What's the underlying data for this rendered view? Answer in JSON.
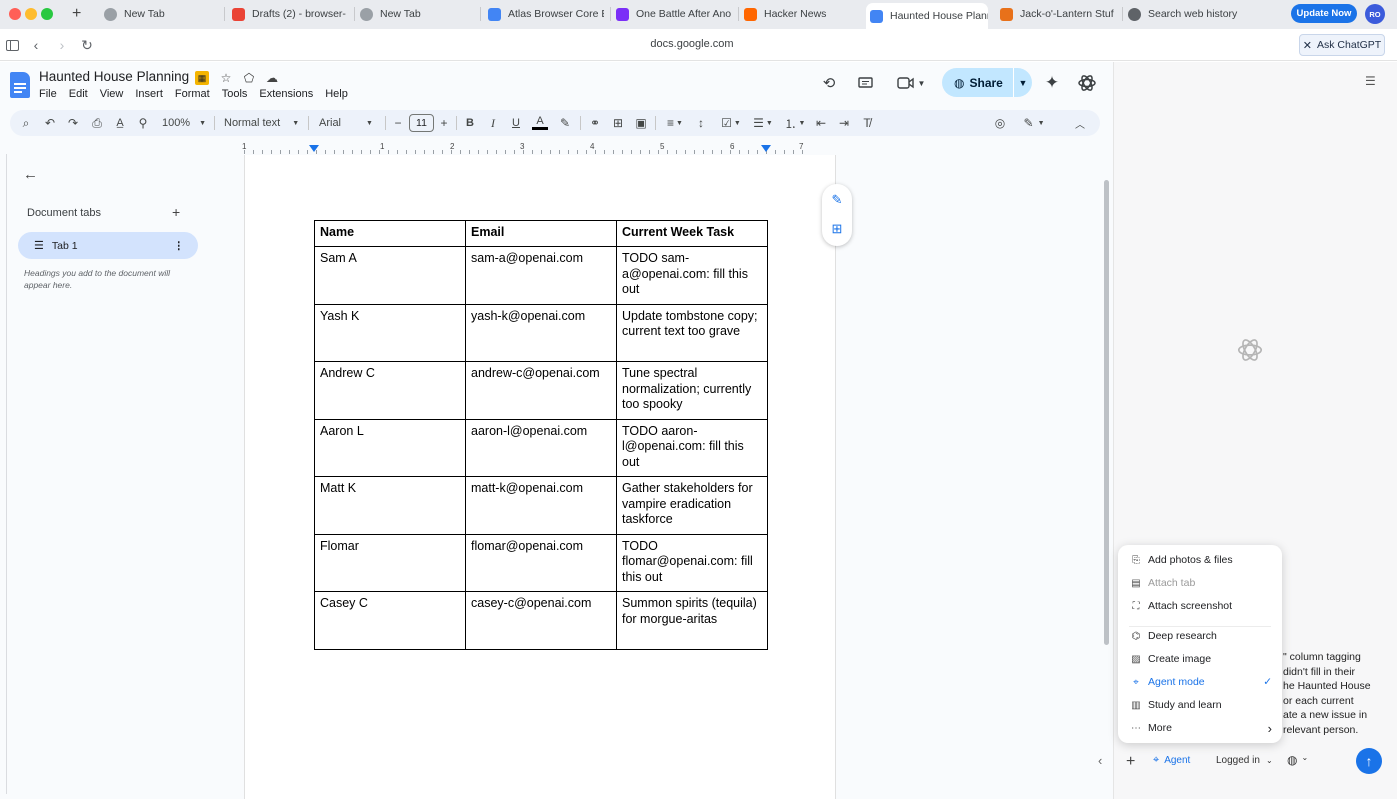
{
  "tabs": [
    {
      "label": "New Tab",
      "icon": "compass-icon",
      "color": "#9aa0a6"
    },
    {
      "label": "Drafts (2) - browser-",
      "icon": "gmail-icon",
      "color": "#ea4335"
    },
    {
      "label": "New Tab",
      "icon": "compass-icon",
      "color": "#9aa0a6"
    },
    {
      "label": "Atlas Browser Core E",
      "icon": "docs-icon",
      "color": "#4285f4"
    },
    {
      "label": "One Battle After Ano",
      "icon": "film-icon",
      "color": "#7b2ff7"
    },
    {
      "label": "Hacker News",
      "icon": "hn-icon",
      "color": "#ff6600"
    },
    {
      "label": "Haunted House Plann",
      "icon": "docs-icon",
      "color": "#4285f4",
      "active": true
    },
    {
      "label": "Jack-o'-Lantern Stuf",
      "icon": "pumpkin-icon",
      "color": "#e8711a"
    },
    {
      "label": "Search web history",
      "icon": "history-icon",
      "color": "#5f6368"
    }
  ],
  "topbar": {
    "update_label": "Update Now",
    "avatar_initials": "RO"
  },
  "address": {
    "url": "docs.google.com",
    "ask_label": "Ask ChatGPT"
  },
  "doc": {
    "title": "Haunted House Planning",
    "menus": [
      "File",
      "Edit",
      "View",
      "Insert",
      "Format",
      "Tools",
      "Extensions",
      "Help"
    ],
    "share_label": "Share"
  },
  "toolbar": {
    "zoom": "100%",
    "style": "Normal text",
    "font": "Arial",
    "font_size": "11"
  },
  "ruler": {
    "numbers": [
      "1",
      "1",
      "2",
      "3",
      "4",
      "5",
      "6",
      "7"
    ]
  },
  "sidebar": {
    "heading": "Document tabs",
    "tab_label": "Tab 1",
    "note": "Headings you add to the document will appear here."
  },
  "table": {
    "headers": [
      "Name",
      "Email",
      "Current Week Task"
    ],
    "rows": [
      [
        "Sam A",
        "sam-a@openai.com",
        "TODO sam-a@openai.com: fill this out"
      ],
      [
        "Yash K",
        "yash-k@openai.com",
        "Update tombstone copy; current text too grave"
      ],
      [
        "Andrew C",
        "andrew-c@openai.com",
        "Tune spectral normalization; currently too spooky"
      ],
      [
        "Aaron L",
        "aaron-l@openai.com",
        "TODO aaron-l@openai.com: fill this out"
      ],
      [
        "Matt K",
        "matt-k@openai.com",
        "Gather stakeholders for vampire eradication taskforce"
      ],
      [
        "Flomar",
        "flomar@openai.com",
        "TODO flomar@openai.com: fill this out"
      ],
      [
        "Casey C",
        "casey-c@openai.com",
        "Summon spirits (tequila) for morgue-aritas"
      ]
    ]
  },
  "chat": {
    "partial_lines": [
      "\" column tagging",
      "didn't fill in their",
      "he Haunted House",
      "or each current",
      "ate a new issue in",
      "relevant person."
    ]
  },
  "popup": {
    "items": [
      {
        "label": "Add photos & files",
        "icon": "paperclip-icon"
      },
      {
        "label": "Attach tab",
        "icon": "tab-icon",
        "disabled": true
      },
      {
        "label": "Attach screenshot",
        "icon": "screenshot-icon"
      },
      {
        "label": "Deep research",
        "icon": "telescope-icon"
      },
      {
        "label": "Create image",
        "icon": "image-icon"
      },
      {
        "label": "Agent mode",
        "icon": "agent-icon",
        "selected": true
      },
      {
        "label": "Study and learn",
        "icon": "book-icon"
      },
      {
        "label": "More",
        "icon": "more-icon",
        "submenu": true
      }
    ]
  },
  "composer": {
    "agent_label": "Agent",
    "login_label": "Logged in"
  }
}
